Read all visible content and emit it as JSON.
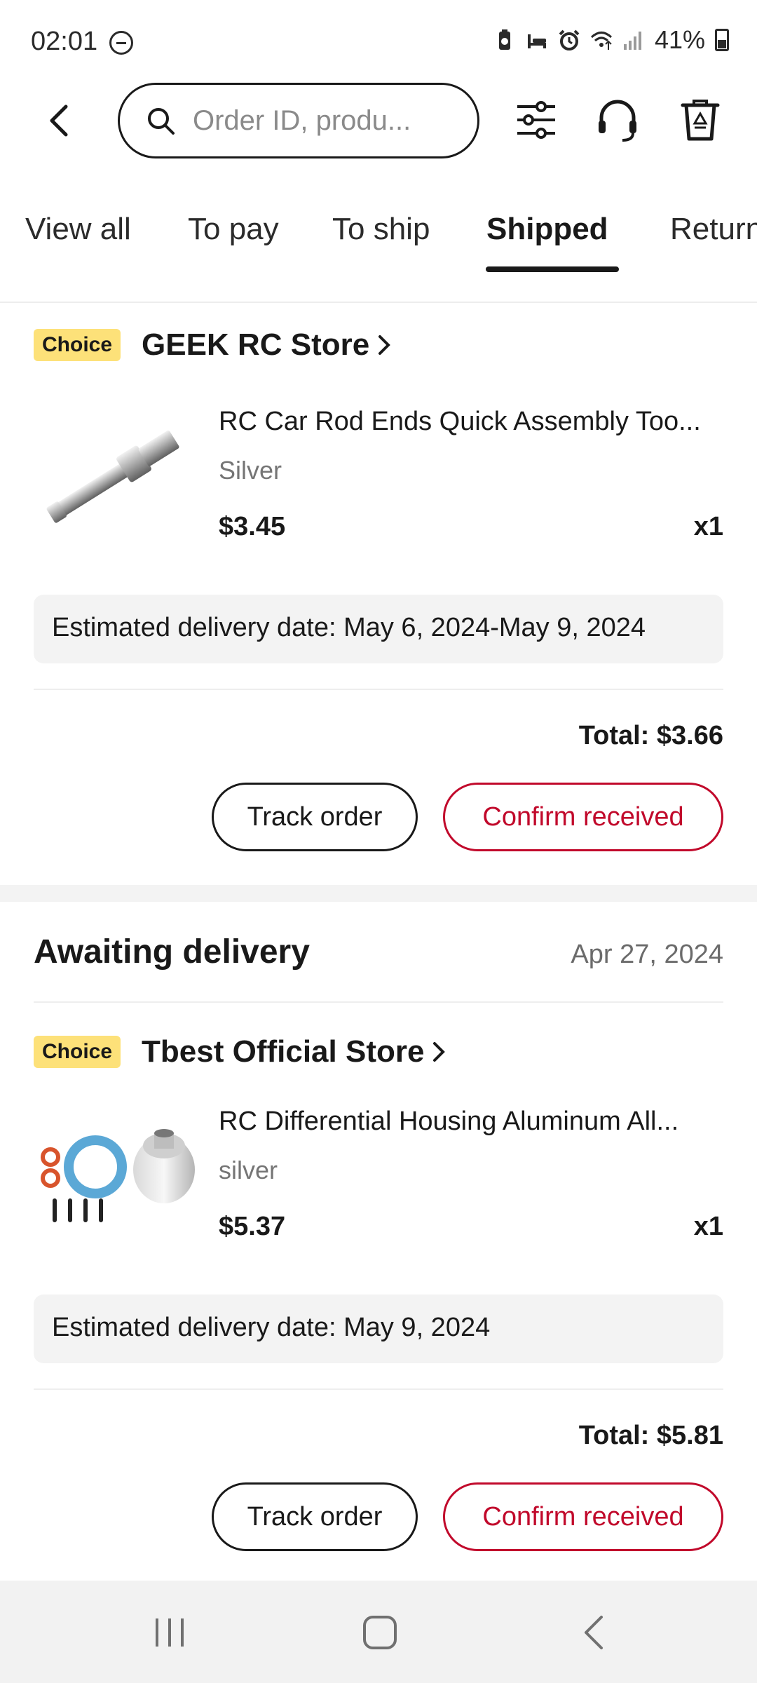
{
  "status_bar": {
    "time": "02:01",
    "battery_text": "41%",
    "icons": [
      "do-not-disturb-icon",
      "battery-saver-icon",
      "sleep-icon",
      "alarm-icon",
      "wifi-icon",
      "signal-icon",
      "battery-icon"
    ]
  },
  "header": {
    "search_placeholder": "Order ID, produ...",
    "icons": [
      "back-arrow-icon",
      "search-icon",
      "filter-sliders-icon",
      "headset-support-icon",
      "recycle-bin-icon"
    ]
  },
  "tabs": [
    {
      "label": "View all",
      "active": false
    },
    {
      "label": "To pay",
      "active": false
    },
    {
      "label": "To ship",
      "active": false
    },
    {
      "label": "Shipped",
      "active": true
    },
    {
      "label": "Return",
      "active": false
    }
  ],
  "orders": [
    {
      "badge": "Choice",
      "store": "GEEK RC Store",
      "product_title": "RC Car Rod Ends Quick Assembly Too...",
      "variant": "Silver",
      "price": "$3.45",
      "qty": "x1",
      "estimated_delivery": "Estimated delivery date: May 6, 2024-May 9, 2024",
      "total": "Total: $3.66",
      "track_label": "Track order",
      "confirm_label": "Confirm received"
    },
    {
      "status": "Awaiting delivery",
      "order_date": "Apr 27, 2024",
      "badge": "Choice",
      "store": "Tbest Official Store",
      "product_title": "RC Differential Housing Aluminum All...",
      "variant": "silver",
      "price": "$5.37",
      "qty": "x1",
      "estimated_delivery": "Estimated delivery date: May 9, 2024",
      "total": "Total: $5.81",
      "track_label": "Track order",
      "confirm_label": "Confirm received"
    }
  ],
  "colors": {
    "accent_red": "#c1092b",
    "choice_badge": "#fde179",
    "text_primary": "#191919",
    "text_secondary": "#757575"
  }
}
